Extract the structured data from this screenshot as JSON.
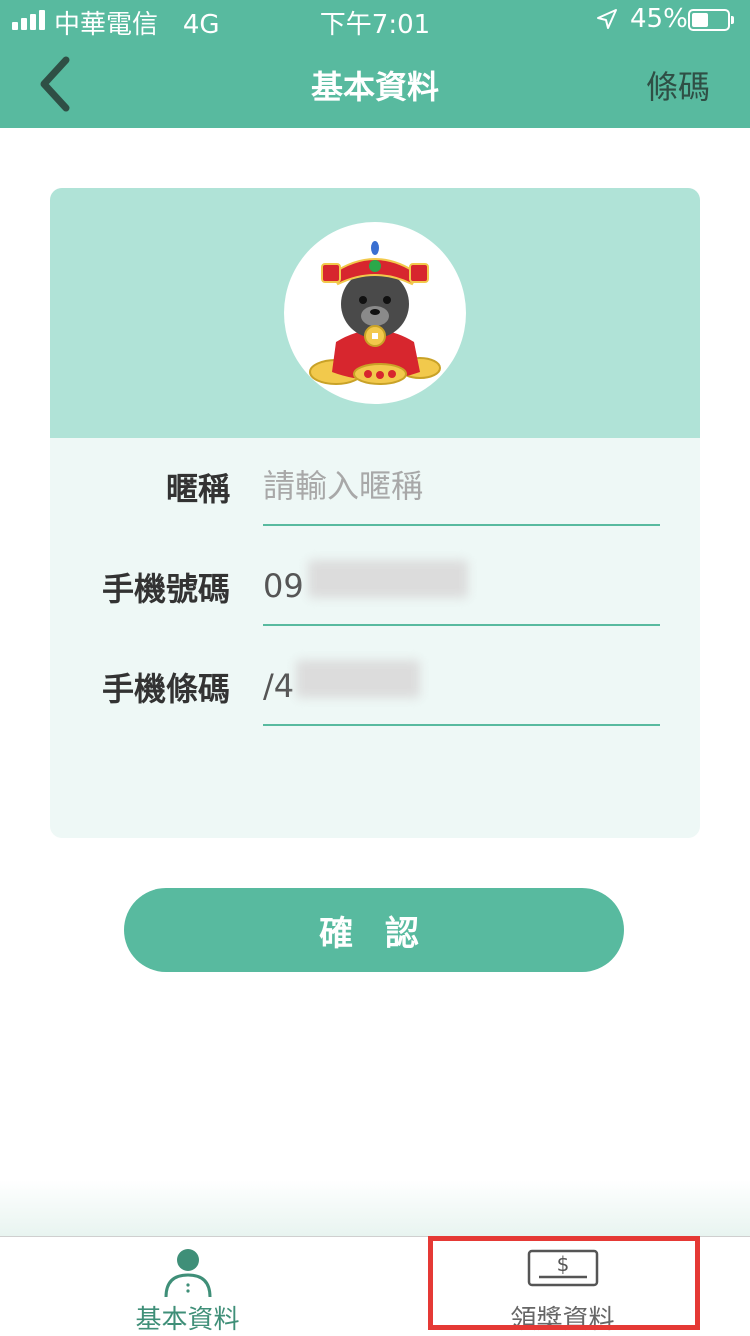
{
  "status_bar": {
    "carrier": "中華電信",
    "network": "4G",
    "time": "下午7:01",
    "battery": "45%"
  },
  "nav": {
    "title": "基本資料",
    "right_action": "條碼",
    "back_icon": "chevron-left-icon"
  },
  "profile": {
    "avatar_icon": "mascot-bear-avatar",
    "fields": [
      {
        "label": "暱稱",
        "value": "",
        "placeholder": "請輸入暱稱"
      },
      {
        "label": "手機號碼",
        "value": "09",
        "placeholder": ""
      },
      {
        "label": "手機條碼",
        "value": "/4",
        "placeholder": ""
      }
    ]
  },
  "confirm_button": "確 認",
  "tabs": [
    {
      "label": "基本資料",
      "icon": "person-icon",
      "active": true
    },
    {
      "label": "領獎資料",
      "icon": "money-icon",
      "active": false
    }
  ],
  "colors": {
    "primary": "#58ba9f",
    "card_header": "#b0e3d7",
    "card_body": "#eef8f6",
    "highlight": "#e53935"
  }
}
